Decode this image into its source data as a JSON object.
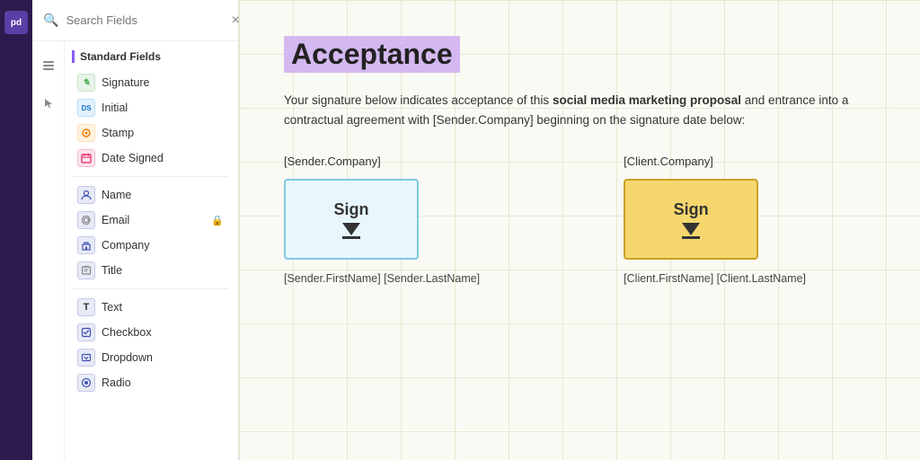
{
  "app": {
    "logo_text": "pd",
    "logo_alt": "PandaDoc"
  },
  "sidebar": {
    "search_placeholder": "Search Fields",
    "close_label": "×",
    "section_title": "Standard Fields",
    "fields_group1": [
      {
        "id": "signature",
        "label": "Signature",
        "icon_type": "sig",
        "icon_label": "✍"
      },
      {
        "id": "initial",
        "label": "Initial",
        "icon_type": "ini",
        "icon_label": "DS"
      },
      {
        "id": "stamp",
        "label": "Stamp",
        "icon_type": "stamp",
        "icon_label": "⊕"
      },
      {
        "id": "date_signed",
        "label": "Date Signed",
        "icon_type": "date",
        "icon_label": "◫"
      }
    ],
    "fields_group2": [
      {
        "id": "name",
        "label": "Name",
        "icon_type": "name",
        "icon_label": "A",
        "locked": false
      },
      {
        "id": "email",
        "label": "Email",
        "icon_type": "email",
        "icon_label": "@",
        "locked": true
      },
      {
        "id": "company",
        "label": "Company",
        "icon_type": "company",
        "icon_label": "⊕",
        "locked": false
      },
      {
        "id": "title",
        "label": "Title",
        "icon_type": "title_f",
        "icon_label": "🔒",
        "locked": false
      }
    ],
    "fields_group3": [
      {
        "id": "text",
        "label": "Text",
        "icon_type": "text",
        "icon_label": "T"
      },
      {
        "id": "checkbox",
        "label": "Checkbox",
        "icon_type": "check",
        "icon_label": "☑"
      },
      {
        "id": "dropdown",
        "label": "Dropdown",
        "icon_type": "drop",
        "icon_label": "▾"
      },
      {
        "id": "radio",
        "label": "Radio",
        "icon_type": "radio",
        "icon_label": "◎"
      }
    ]
  },
  "document": {
    "title": "Acceptance",
    "body_text_start": "Your signature below indicates acceptance of this ",
    "body_text_bold": "social media marketing proposal",
    "body_text_end": " and entrance into a contractual agreement with [Sender.Company] beginning on the signature date below:",
    "sender_label": "[Sender.Company]",
    "client_label": "[Client.Company]",
    "sign_text": "Sign",
    "sender_name_label": "[Sender.FirstName] [Sender.LastName]",
    "client_name_label": "[Client.FirstName] [Client.LastName]"
  }
}
